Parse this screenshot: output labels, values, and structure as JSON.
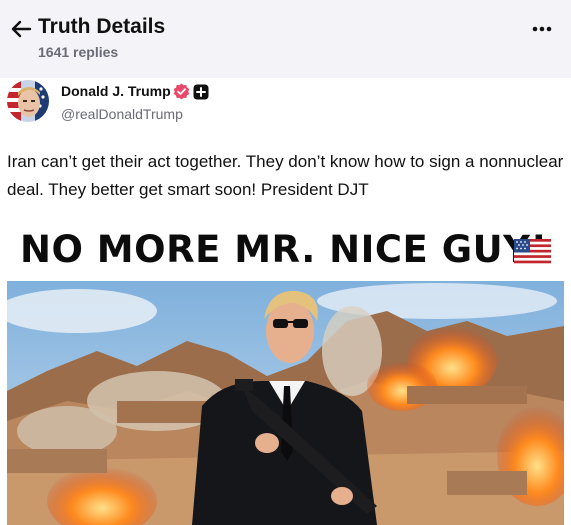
{
  "header": {
    "title": "Truth Details",
    "replies": "1641 replies"
  },
  "post": {
    "author_name": "Donald J. Trump",
    "author_handle": "@realDonaldTrump",
    "text": "Iran can’t get their act together. They don’t know how to sign a nonnuclear deal. They better get smart soon! President DJT",
    "image_headline": "NO MORE MR. NICE GUY!"
  },
  "icons": {
    "back": "arrow-left-icon",
    "more": "more-horizontal-icon",
    "verified": "verified-badge-icon",
    "plus": "plus-badge-icon"
  },
  "colors": {
    "header_bg": "#f4f3f7",
    "verified": "#e8496b",
    "text": "#111111",
    "muted": "#6b6b78"
  }
}
